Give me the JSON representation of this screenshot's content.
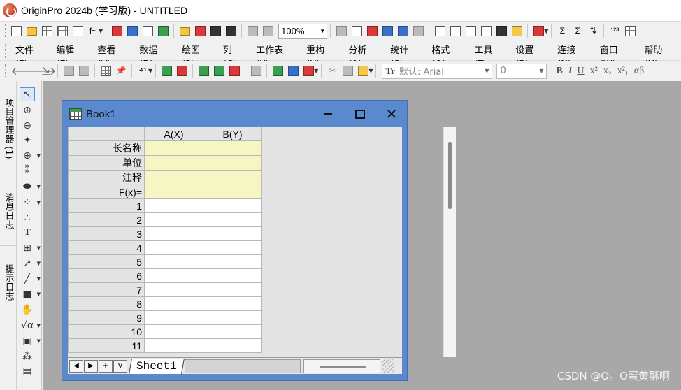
{
  "app": {
    "title": "OriginPro 2024b (学习版) - UNTITLED"
  },
  "toolbar": {
    "zoom_value": "100%"
  },
  "menubar": {
    "items": [
      "文件(F)",
      "编辑(E)",
      "查看(V)",
      "数据(D)",
      "绘图(P)",
      "列(C)",
      "工作表(K)",
      "重构(U)",
      "分析(A)",
      "统计(S)",
      "格式(O)",
      "工具(T)",
      "设置(R)",
      "连接(N)",
      "窗口(W)",
      "帮助(H)"
    ]
  },
  "format_toolbar": {
    "font_value": "默认: Arial",
    "font_size_value": "0",
    "buttons": [
      "B",
      "I",
      "U",
      "x²",
      "x₂",
      "x²₁",
      "αβ"
    ]
  },
  "side_tabs": [
    "项目管理器 (1)",
    "消息日志",
    "提示日志"
  ],
  "workbook": {
    "title": "Book1",
    "columns": [
      "A(X)",
      "B(Y)"
    ],
    "meta_rows": [
      "长名称",
      "单位",
      "注释",
      "F(x)="
    ],
    "data_rows": [
      "1",
      "2",
      "3",
      "4",
      "5",
      "6",
      "7",
      "8",
      "9",
      "10",
      "11"
    ],
    "sheet_tab": "Sheet1",
    "nav_buttons": [
      "◀",
      "▶",
      "+",
      "V"
    ]
  },
  "watermark": "CSDN @O。O蛋黄酥啊",
  "colors": {
    "window_frame": "#5a89cd",
    "meta_cell": "#f6f5c4",
    "workspace": "#a8a8a8"
  }
}
